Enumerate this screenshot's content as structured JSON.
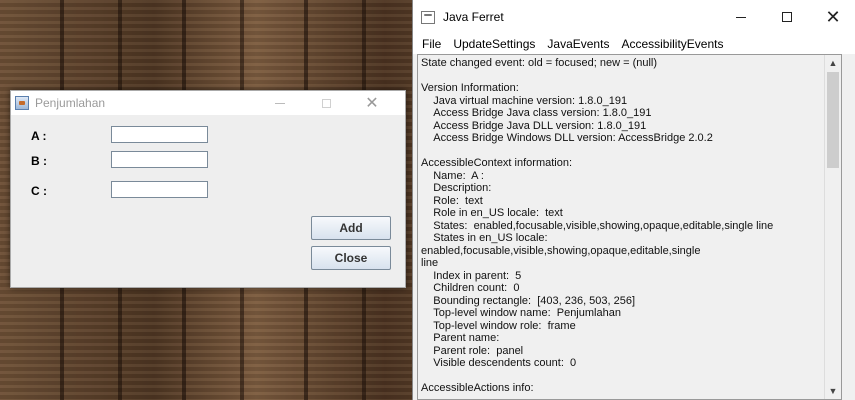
{
  "penjumlahan": {
    "title": "Penjumlahan",
    "labels": {
      "a": "A :",
      "b": "B :",
      "c": "C :"
    },
    "buttons": {
      "add": "Add",
      "close": "Close"
    }
  },
  "ferret": {
    "title": "Java Ferret",
    "menu": [
      "File",
      "UpdateSettings",
      "JavaEvents",
      "AccessibilityEvents"
    ],
    "output_lines": [
      "State changed event: old = focused; new = (null)",
      "",
      "Version Information:",
      "    Java virtual machine version: 1.8.0_191",
      "    Access Bridge Java class version: 1.8.0_191",
      "    Access Bridge Java DLL version: 1.8.0_191",
      "    Access Bridge Windows DLL version: AccessBridge 2.0.2",
      "",
      "AccessibleContext information:",
      "    Name:  A :",
      "    Description:",
      "    Role:  text",
      "    Role in en_US locale:  text",
      "    States:  enabled,focusable,visible,showing,opaque,editable,single line",
      "    States in en_US locale:  enabled,focusable,visible,showing,opaque,editable,single",
      "line",
      "    Index in parent:  5",
      "    Children count:  0",
      "    Bounding rectangle:  [403, 236, 503, 256]",
      "    Top-level window name:  Penjumlahan",
      "    Top-level window role:  frame",
      "    Parent name:",
      "    Parent role:  panel",
      "    Visible descendents count:  0",
      "",
      "AccessibleActions info:"
    ]
  }
}
